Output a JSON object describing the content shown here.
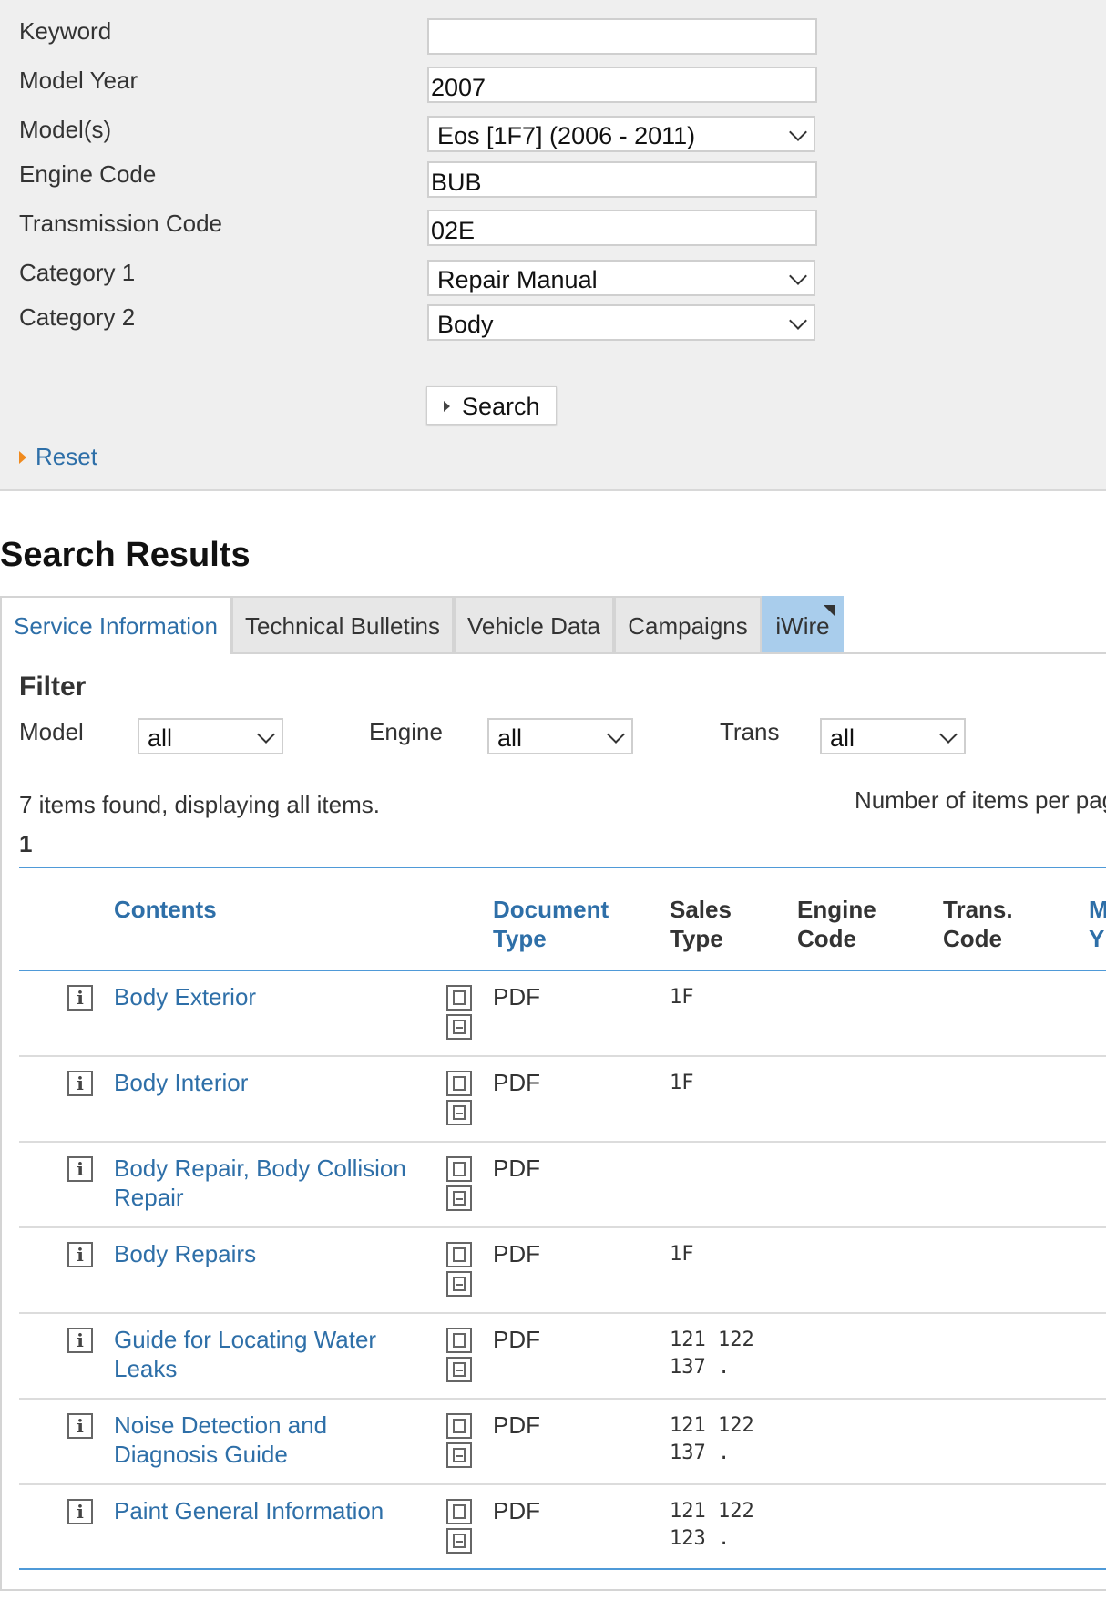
{
  "search_form": {
    "fields": {
      "keyword": {
        "label": "Keyword",
        "value": ""
      },
      "model_year": {
        "label": "Model Year",
        "value": "2007"
      },
      "models": {
        "label": "Model(s)",
        "value": "Eos [1F7] (2006 - 2011)"
      },
      "engine_code": {
        "label": "Engine Code",
        "value": "BUB"
      },
      "transmission_code": {
        "label": "Transmission Code",
        "value": "02E"
      },
      "category1": {
        "label": "Category 1",
        "value": "Repair Manual"
      },
      "category2": {
        "label": "Category 2",
        "value": "Body"
      }
    },
    "search_label": "Search",
    "reset_label": "Reset"
  },
  "results": {
    "title": "Search Results",
    "tabs": [
      "Service Information",
      "Technical Bulletins",
      "Vehicle Data",
      "Campaigns",
      "iWire"
    ],
    "active_tab": "Service Information",
    "filter": {
      "title": "Filter",
      "model": {
        "label": "Model",
        "value": "all"
      },
      "engine": {
        "label": "Engine",
        "value": "all"
      },
      "trans": {
        "label": "Trans",
        "value": "all"
      }
    },
    "summary": "7 items found, displaying all items.",
    "items_per_page_label": "Number of items per pag",
    "page_number": "1",
    "columns": {
      "contents": "Contents",
      "document_type_1": "Document",
      "document_type_2": "Type",
      "sales_type_1": "Sales",
      "sales_type_2": "Type",
      "engine_code_1": "Engine",
      "engine_code_2": "Code",
      "trans_code_1": "Trans.",
      "trans_code_2": "Code",
      "model_year_1": "M",
      "model_year_2": "Y"
    },
    "rows": [
      {
        "title": "Body Exterior",
        "doc_type": "PDF",
        "sales_type": "1F"
      },
      {
        "title": "Body Interior",
        "doc_type": "PDF",
        "sales_type": "1F"
      },
      {
        "title": "Body Repair, Body Collision Repair",
        "doc_type": "PDF",
        "sales_type": ""
      },
      {
        "title": "Body Repairs",
        "doc_type": "PDF",
        "sales_type": "1F"
      },
      {
        "title": "Guide for Locating Water Leaks",
        "doc_type": "PDF",
        "sales_type": "121 122\n137 ."
      },
      {
        "title": "Noise Detection and Diagnosis Guide",
        "doc_type": "PDF",
        "sales_type": "121 122\n137 ."
      },
      {
        "title": "Paint General Information",
        "doc_type": "PDF",
        "sales_type": "121 122\n123 ."
      }
    ]
  },
  "colors": {
    "link": "#2e6fa8",
    "accent_line": "#4f9ad8",
    "reset_arrow": "#f08a1e",
    "iwire_tab": "#a9cdec"
  }
}
